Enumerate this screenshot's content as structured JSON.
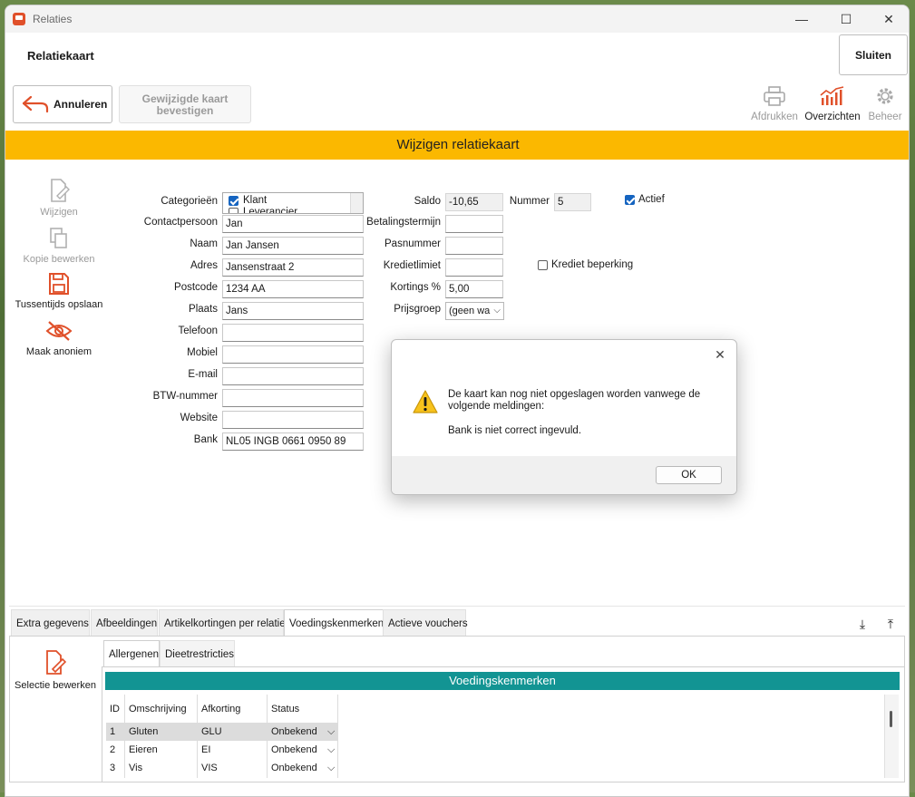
{
  "window": {
    "title": "Relaties",
    "minimize": "—",
    "maximize": "☐",
    "close": "✕"
  },
  "header": {
    "title": "Relatiekaart",
    "close_label": "Sluiten"
  },
  "toolbar": {
    "cancel_label": "Annuleren",
    "confirm_label_line1": "Gewijzigde kaart",
    "confirm_label_line2": "bevestigen",
    "print_label": "Afdrukken",
    "overviews_label": "Overzichten",
    "manage_label": "Beheer"
  },
  "banner": {
    "title": "Wijzigen relatiekaart"
  },
  "side_actions": {
    "edit": "Wijzigen",
    "copy_edit": "Kopie bewerken",
    "save_interim": "Tussentijds opslaan",
    "anonymize": "Maak anoniem"
  },
  "form": {
    "categories_label": "Categorieën",
    "categories": [
      {
        "label": "Klant",
        "checked": true
      },
      {
        "label": "Leverancier",
        "checked": false
      }
    ],
    "contactpersoon_label": "Contactpersoon",
    "contactpersoon": "Jan",
    "naam_label": "Naam",
    "naam": "Jan Jansen",
    "adres_label": "Adres",
    "adres": "Jansenstraat 2",
    "postcode_label": "Postcode",
    "postcode": "1234 AA",
    "plaats_label": "Plaats",
    "plaats": "Jans",
    "telefoon_label": "Telefoon",
    "telefoon": "",
    "mobiel_label": "Mobiel",
    "mobiel": "",
    "email_label": "E-mail",
    "email": "",
    "btw_label": "BTW-nummer",
    "btw": "",
    "website_label": "Website",
    "website": "",
    "bank_label": "Bank",
    "bank": "NL05 INGB 0661 0950 89",
    "saldo_label": "Saldo",
    "saldo": "-10,65",
    "nummer_label": "Nummer",
    "nummer": "5",
    "actief_label": "Actief",
    "betalingstermijn_label": "Betalingstermijn",
    "betalingstermijn": "",
    "pasnummer_label": "Pasnummer",
    "pasnummer": "",
    "kredietlimiet_label": "Kredietlimiet",
    "kredietlimiet": "",
    "krediet_beperking_label": "Krediet beperking",
    "kortings_label": "Kortings %",
    "kortings": "5,00",
    "prijsgroep_label": "Prijsgroep",
    "prijsgroep": "(geen wa"
  },
  "tabs": [
    "Extra gegevens",
    "Afbeeldingen",
    "Artikelkortingen per relatie",
    "Voedingskenmerken",
    "Actieve vouchers"
  ],
  "subtabs": [
    "Allergenen",
    "Dieetrestricties"
  ],
  "panel": {
    "selection_edit_label": "Selectie bewerken",
    "section_title": "Voedingskenmerken",
    "columns": [
      "ID",
      "Omschrijving",
      "Afkorting",
      "Status"
    ],
    "rows": [
      {
        "id": "1",
        "omschrijving": "Gluten",
        "afkorting": "GLU",
        "status": "Onbekend"
      },
      {
        "id": "2",
        "omschrijving": "Eieren",
        "afkorting": "EI",
        "status": "Onbekend"
      },
      {
        "id": "3",
        "omschrijving": "Vis",
        "afkorting": "VIS",
        "status": "Onbekend"
      }
    ]
  },
  "dialog": {
    "message_line1": "De kaart kan nog niet opgeslagen worden vanwege de volgende meldingen:",
    "message_line2": "Bank is niet correct ingevuld.",
    "ok_label": "OK",
    "close": "✕"
  },
  "colors": {
    "accent_orange": "#e0502a",
    "banner_yellow": "#fbb800",
    "teal": "#129493"
  }
}
